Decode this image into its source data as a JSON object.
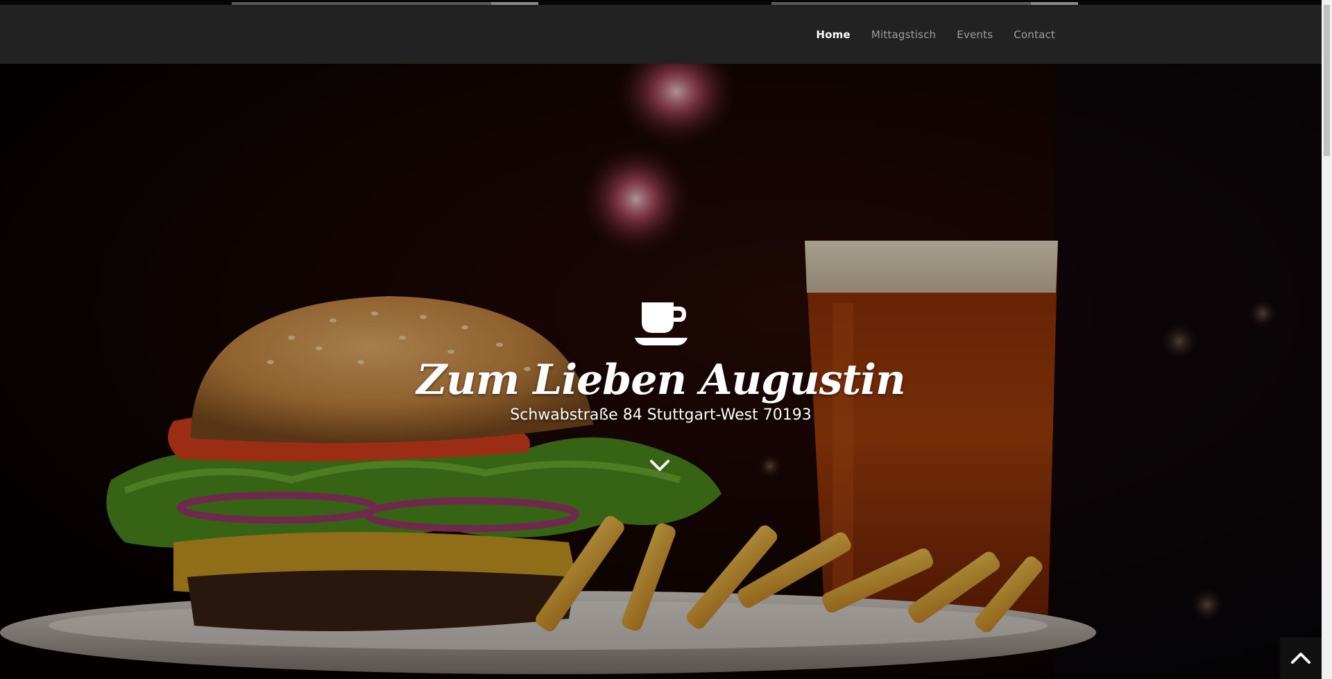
{
  "nav": {
    "items": [
      {
        "label": "Home",
        "active": true
      },
      {
        "label": "Mittagstisch",
        "active": false
      },
      {
        "label": "Events",
        "active": false
      },
      {
        "label": "Contact",
        "active": false
      }
    ]
  },
  "hero": {
    "icon": "coffee-cup-icon",
    "title": "Zum Lieben Augustin",
    "subtitle": "Schwabstraße 84 Stuttgart-West 70193",
    "scroll_down_icon": "chevron-down-icon",
    "back_to_top_icon": "chevron-up-icon"
  },
  "colors": {
    "navbar_bg": "#222222",
    "nav_text": "#9d9d9d",
    "nav_active": "#ffffff",
    "hero_text": "#ffffff"
  }
}
